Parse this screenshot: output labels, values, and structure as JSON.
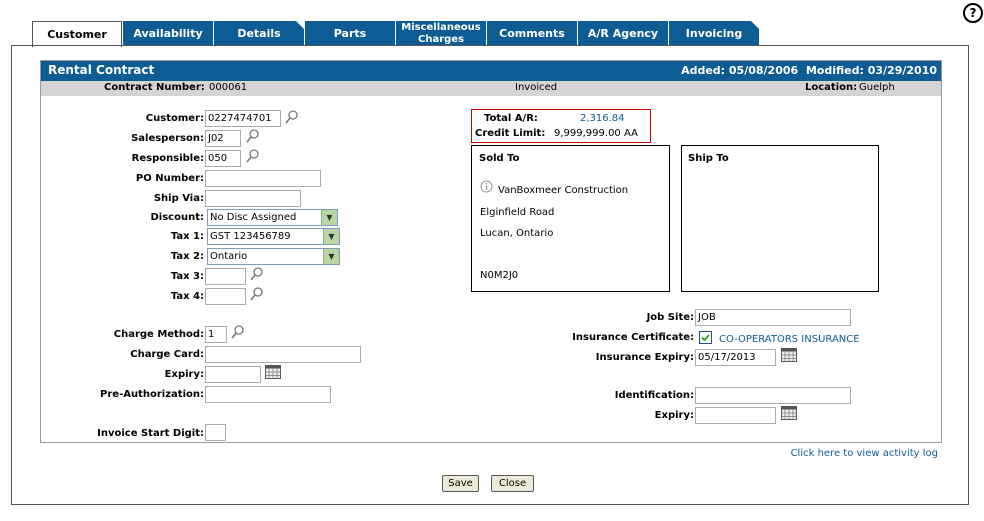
{
  "help_label": "?",
  "tabs": [
    {
      "label": "Customer",
      "active": true
    },
    {
      "label": "Availability"
    },
    {
      "label": "Details"
    },
    {
      "label": "Parts"
    },
    {
      "label": "Miscellaneous Charges",
      "line1": "Miscellaneous",
      "line2": "Charges"
    },
    {
      "label": "Comments"
    },
    {
      "label": "A/R Agency"
    },
    {
      "label": "Invoicing"
    }
  ],
  "header": {
    "title": "Rental Contract",
    "added_label": "Added:",
    "added": "05/08/2006",
    "modified_label": "Modified:",
    "modified": "03/29/2010"
  },
  "info": {
    "contract_label": "Contract Number:",
    "contract_number": "000061",
    "status": "Invoiced",
    "location_label": "Location:",
    "location": "Guelph"
  },
  "form": {
    "customer_label": "Customer:",
    "customer": "0227474701",
    "salesperson_label": "Salesperson:",
    "salesperson": "J02",
    "responsible_label": "Responsible:",
    "responsible": "050",
    "po_label": "PO Number:",
    "po": "",
    "shipvia_label": "Ship Via:",
    "shipvia": "",
    "discount_label": "Discount:",
    "discount": "No Disc Assigned",
    "tax1_label": "Tax 1:",
    "tax1": "GST 123456789",
    "tax2_label": "Tax 2:",
    "tax2": "Ontario",
    "tax3_label": "Tax 3:",
    "tax3": "",
    "tax4_label": "Tax 4:",
    "tax4": "",
    "charge_method_label": "Charge Method:",
    "charge_method": "1",
    "charge_card_label": "Charge Card:",
    "charge_card": "",
    "expiry_label": "Expiry:",
    "expiry": "",
    "preauth_label": "Pre-Authorization:",
    "preauth": "",
    "invoice_start_label": "Invoice Start Digit:",
    "invoice_start": ""
  },
  "ar": {
    "total_label": "Total A/R:",
    "total": "2,316.84",
    "credit_label": "Credit Limit:",
    "credit": "9,999,999.00 AA"
  },
  "sold_to": {
    "title": "Sold To",
    "name": "VanBoxmeer Construction",
    "line1": "Elginfield Road",
    "line2": "Lucan, Ontario",
    "postal": "N0M2J0"
  },
  "ship_to": {
    "title": "Ship To"
  },
  "right": {
    "jobsite_label": "Job Site:",
    "jobsite": "JOB",
    "insurance_label": "Insurance Certificate:",
    "insurance_company": "CO-OPERATORS INSURANCE",
    "insurance_expiry_label": "Insurance Expiry:",
    "insurance_expiry": "05/17/2013",
    "identification_label": "Identification:",
    "identification": "",
    "id_expiry_label": "Expiry:",
    "id_expiry": ""
  },
  "activity_link": "Click here to view activity log",
  "buttons": {
    "save": "Save",
    "close": "Close"
  },
  "colors": {
    "brand": "#0d5c94",
    "info_bar": "#d4d4d4",
    "ar_border": "#cc0000"
  }
}
